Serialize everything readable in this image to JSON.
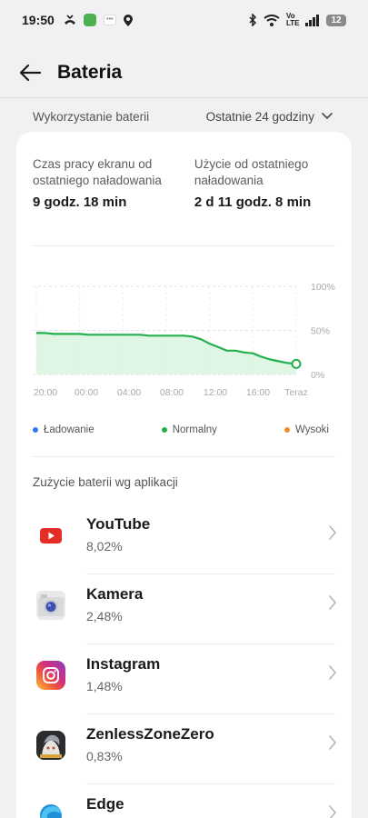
{
  "status_bar": {
    "time": "19:50",
    "battery_level": "12",
    "network_label": "Vo LTE"
  },
  "header": {
    "title": "Bateria",
    "back_icon": "arrow-left-icon"
  },
  "usage": {
    "label": "Wykorzystanie baterii",
    "period": "Ostatnie 24 godziny"
  },
  "stats": {
    "screen_time_label": "Czas pracy ekranu od ostatniego naładowania",
    "screen_time_value": "9 godz. 18 min",
    "since_charge_label": "Użycie od ostatniego naładowania",
    "since_charge_value": "2 d 11 godz. 8 min"
  },
  "chart_data": {
    "type": "area",
    "x_ticks": [
      "20:00",
      "00:00",
      "04:00",
      "08:00",
      "12:00",
      "16:00",
      "Teraz"
    ],
    "y_ticks": [
      "100%",
      "50%",
      "0%"
    ],
    "ylim": [
      0,
      100
    ],
    "grid": true,
    "series": [
      {
        "name": "Normalny",
        "color": "#22b14c",
        "x_hours": [
          0,
          0.8,
          1.6,
          2.4,
          3.2,
          4.0,
          4.8,
          5.6,
          6.4,
          7.2,
          8.0,
          8.8,
          9.6,
          10.4,
          11.2,
          12.0,
          12.8,
          13.6,
          14.4,
          15.2,
          16.0,
          16.8,
          17.6,
          18.4,
          19.2,
          20.0,
          20.8,
          21.6,
          22.4,
          23.2,
          24.0
        ],
        "values": [
          47,
          47,
          46,
          46,
          46,
          46,
          45,
          45,
          45,
          45,
          45,
          45,
          45,
          44,
          44,
          44,
          44,
          44,
          43,
          40,
          35,
          31,
          27,
          27,
          25,
          24,
          20,
          17,
          15,
          13,
          12
        ]
      }
    ]
  },
  "legend": [
    {
      "label": "Ładowanie",
      "color": "#2f7bf5"
    },
    {
      "label": "Normalny",
      "color": "#22b14c"
    },
    {
      "label": "Wysoki",
      "color": "#f28c28"
    }
  ],
  "apps_section": {
    "title": "Zużycie baterii wg aplikacji",
    "apps": [
      {
        "name": "YouTube",
        "percent": "8,02%",
        "icon": "youtube-icon"
      },
      {
        "name": "Kamera",
        "percent": "2,48%",
        "icon": "camera-icon"
      },
      {
        "name": "Instagram",
        "percent": "1,48%",
        "icon": "instagram-icon"
      },
      {
        "name": "ZenlessZoneZero",
        "percent": "0,83%",
        "icon": "zenless-zone-zero-icon"
      },
      {
        "name": "Edge",
        "percent": "",
        "icon": "edge-icon"
      }
    ]
  }
}
